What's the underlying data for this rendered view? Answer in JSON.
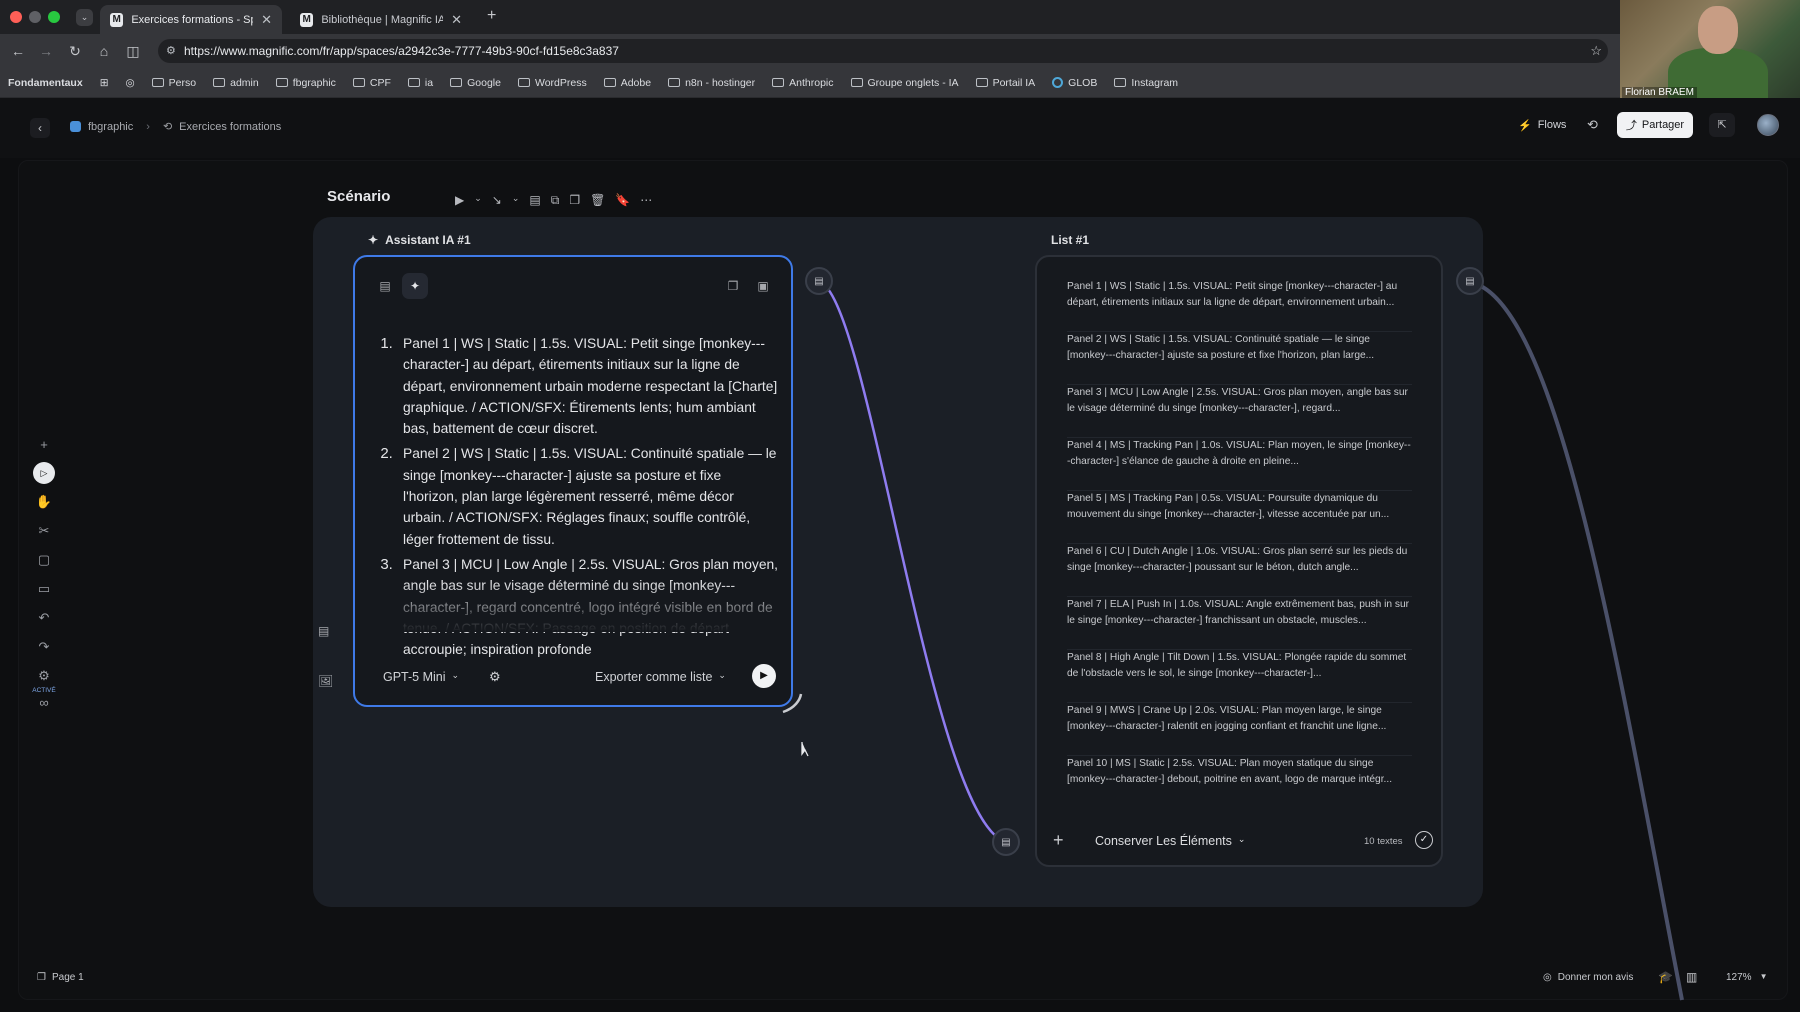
{
  "browser": {
    "tabs": [
      {
        "label": "Exercices formations - Space",
        "active": true
      },
      {
        "label": "Bibliothèque | Magnific IA",
        "active": false
      }
    ],
    "url": "https://www.magnific.com/fr/app/spaces/a2942c3e-7777-49b3-90cf-fd15e8c3a837",
    "bookmarks": [
      "Fondamentaux",
      "Perso",
      "admin",
      "fbgraphic",
      "CPF",
      "ia",
      "Google",
      "WordPress",
      "Adobe",
      "n8n - hostinger",
      "Anthropic",
      "Groupe onglets - IA",
      "Portail IA",
      "GLOB",
      "Instagram"
    ],
    "webcam_name": "Florian BRAEM"
  },
  "header": {
    "breadcrumb": [
      "fbgraphic",
      "Exercices formations"
    ],
    "flows_label": "Flows",
    "share_label": "Partager"
  },
  "canvas": {
    "frame_title": "Scénario",
    "assistant": {
      "title": "Assistant IA #1",
      "items": [
        "Panel 1 | WS | Static | 1.5s. VISUAL: Petit singe [monkey---character-] au départ, étirements initiaux sur la ligne de départ, environnement urbain moderne respectant la [Charte] graphique. / ACTION/SFX: Étirements lents; hum ambiant bas, battement de cœur discret.",
        "Panel 2 | WS | Static | 1.5s. VISUAL: Continuité spatiale — le singe [monkey---character-] ajuste sa posture et fixe l'horizon, plan large légèrement resserré, même décor urbain. / ACTION/SFX: Réglages finaux; souffle contrôlé, léger frottement de tissu.",
        "Panel 3 | MCU | Low Angle | 2.5s. VISUAL: Gros plan moyen, angle bas sur le visage déterminé du singe [monkey---character-], regard concentré, logo intégré visible en bord de tenue. / ACTION/SFX: Passage en position de départ accroupie; inspiration profonde"
      ],
      "model_label": "GPT-5 Mini",
      "export_label": "Exporter comme liste"
    },
    "list": {
      "title": "List #1",
      "items": [
        "Panel 1 | WS | Static | 1.5s. VISUAL: Petit singe [monkey---character-] au départ, étirements initiaux sur la ligne de départ, environnement urbain...",
        "Panel 2 | WS | Static | 1.5s. VISUAL: Continuité spatiale — le singe [monkey---character-] ajuste sa posture et fixe l'horizon, plan large...",
        "Panel 3 | MCU | Low Angle | 2.5s. VISUAL: Gros plan moyen, angle bas sur le visage déterminé du singe [monkey---character-], regard...",
        "Panel 4 | MS | Tracking Pan | 1.0s. VISUAL: Plan moyen, le singe [monkey---character-] s'élance de gauche à droite en pleine...",
        "Panel 5 | MS | Tracking Pan | 0.5s. VISUAL: Poursuite dynamique du mouvement du singe [monkey---character-], vitesse accentuée par un...",
        "Panel 6 | CU | Dutch Angle | 1.0s. VISUAL: Gros plan serré sur les pieds du singe [monkey---character-] poussant sur le béton, dutch angle...",
        "Panel 7 | ELA | Push In | 1.0s. VISUAL: Angle extrêmement bas, push in sur le singe [monkey---character-] franchissant un obstacle, muscles...",
        "Panel 8 | High Angle | Tilt Down | 1.5s. VISUAL: Plongée rapide du sommet de l'obstacle vers le sol, le singe [monkey---character-]...",
        "Panel 9 | MWS | Crane Up | 2.0s. VISUAL: Plan moyen large, le singe [monkey---character-] ralentit en jogging confiant et franchit une ligne...",
        "Panel 10 | MS | Static | 2.5s. VISUAL: Plan moyen statique du singe [monkey---character-] debout, poitrine en avant, logo de marque intégr..."
      ],
      "keep_label": "Conserver Les Éléments",
      "count_label": "10 textes"
    }
  },
  "sidebar": {
    "active_label": "ACTIVÉ"
  },
  "bottom": {
    "page_label": "Page 1",
    "feedback_label": "Donner mon avis",
    "zoom": "127%"
  },
  "colors": {
    "accent": "#3f7ae8",
    "edge": "#8f7cf0",
    "bg": "#0d0e10"
  }
}
